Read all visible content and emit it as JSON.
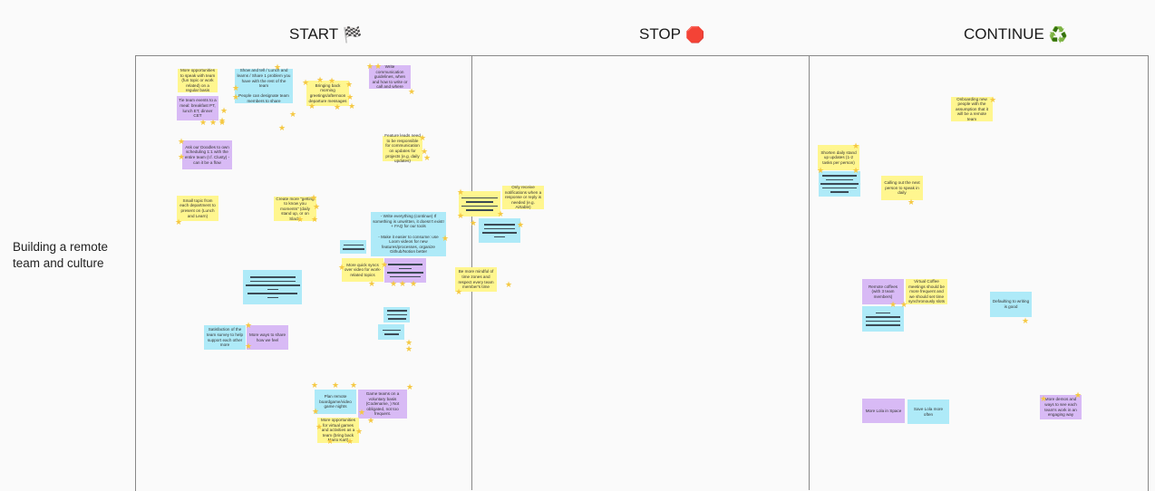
{
  "columns": [
    {
      "title": "START",
      "emoji": "🏁"
    },
    {
      "title": "STOP",
      "emoji": "🛑"
    },
    {
      "title": "CONTINUE",
      "emoji": "♻️"
    }
  ],
  "row_label": "Building a remote team and culture",
  "start_notes": [
    {
      "text": "More opportunities to speak with team (fun topic or work related) on a regular basis",
      "color": "yellow"
    },
    {
      "text": "Show and tell / Lunch and learns / Share 1 problem you have with the rest of the team\n\nPeople can designate team members to share",
      "color": "blue"
    },
    {
      "text": "Bringing back morning greetings/afternoon departure messages",
      "color": "yellow"
    },
    {
      "text": "Write communication guidelines, when and how to write or call and where",
      "color": "purple"
    },
    {
      "text": "Tie team events to a meal: breakfast PT, lunch ET, dinner CET",
      "color": "purple"
    },
    {
      "text": "Ask our Doodles to own scheduling 1:1 with the entire team (r.f. Clusty) - can it be a flow",
      "color": "purple"
    },
    {
      "text": "Feature leads need to be responsible for communication on updates for projects (e.g. daily updates)",
      "color": "yellow"
    },
    {
      "text": "Small topic from each department to present on (Lunch and Learn)",
      "color": "yellow"
    },
    {
      "text": "Create more \"getting to know you moments\" (daily stand up, or on Slack)",
      "color": "yellow"
    },
    {
      "text": "- Write everything (continue) If something is unwritten, it doesn't exist! + FAQ for our tools\n\n- Make it easier to consume: use Loom videos for new features/processes, organize Github/Notion better",
      "color": "blue"
    },
    {
      "text": "More quick syncs over video for work-related topics",
      "color": "yellow"
    },
    {
      "text": "Satisfaction of the team survey to help support each other more",
      "color": "blue"
    },
    {
      "text": "More ways to share how we feel",
      "color": "purple"
    },
    {
      "text": "Plan remote boardgame/video game nights",
      "color": "blue"
    },
    {
      "text": "Game teams on a voluntary basis (Codename, ) Not obligated, not too frequent.",
      "color": "purple"
    },
    {
      "text": "More opportunities for virtual games and activities as a team (bring back Mario Kart)",
      "color": "yellow"
    }
  ],
  "stop_notes": [
    {
      "text": "Only receive notifications when a response or reply is needed (e.g. Airtable)",
      "color": "yellow"
    },
    {
      "text": "Be more mindful of time zones and respect every team member's time",
      "color": "yellow"
    }
  ],
  "continue_notes": [
    {
      "text": "Onboarding new people with the assumption that it will be a remote team",
      "color": "yellow"
    },
    {
      "text": "Shorten daily stand up updates (1-2 tasks per person)",
      "color": "yellow"
    },
    {
      "text": "Calling out the next person to speak in daily",
      "color": "yellow"
    },
    {
      "text": "Remote coffees (with 3 team members)",
      "color": "purple"
    },
    {
      "text": "Virtual Coffee meetings should be more frequent and we should set time synchronously slots",
      "color": "yellow"
    },
    {
      "text": "Defaulting to writing is good",
      "color": "blue"
    },
    {
      "text": "More Lola in Space",
      "color": "purple"
    },
    {
      "text": "Save Lola more often",
      "color": "blue"
    },
    {
      "text": "More demos and ways to see each team's work in an engaging way",
      "color": "purple"
    }
  ]
}
